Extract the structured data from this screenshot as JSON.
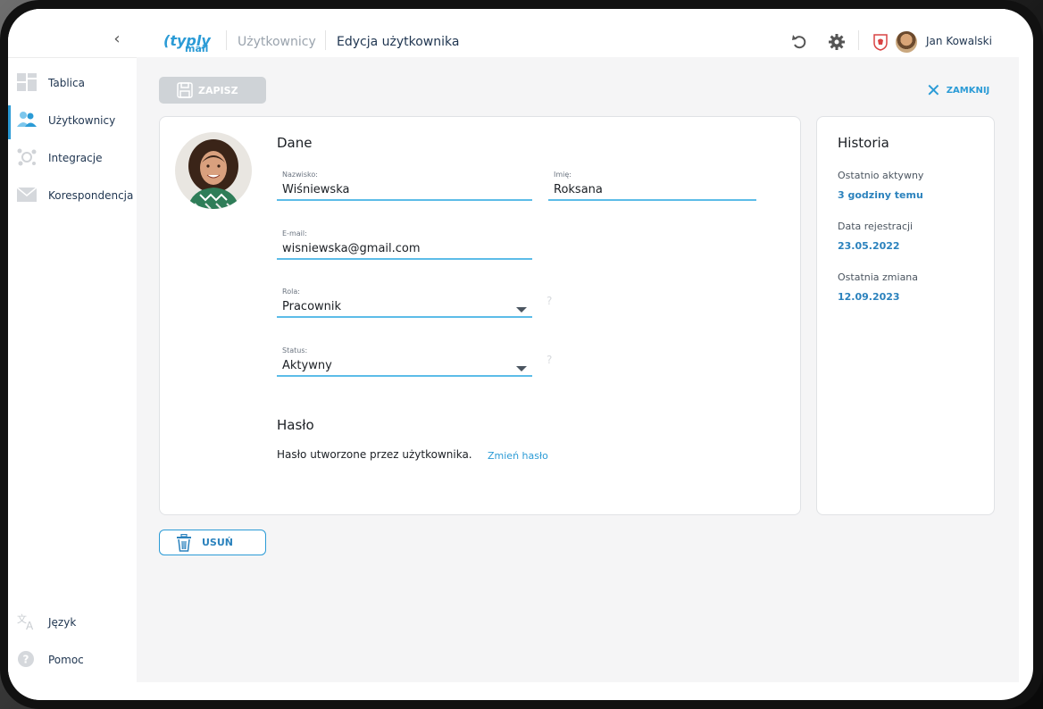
{
  "sidebar": {
    "collapse_icon": "chevron-left-icon",
    "items": [
      {
        "label": "Tablica",
        "icon": "dashboard-icon"
      },
      {
        "label": "Użytkownicy",
        "icon": "users-icon",
        "active": true
      },
      {
        "label": "Integracje",
        "icon": "integrations-icon"
      },
      {
        "label": "Korespondencja",
        "icon": "mail-icon"
      }
    ],
    "bottom_items": [
      {
        "label": "Język",
        "icon": "translate-icon"
      },
      {
        "label": "Pomoc",
        "icon": "help-icon"
      }
    ]
  },
  "header": {
    "logo": "typly mail",
    "breadcrumb": [
      "Użytkownicy",
      "Edycja użytkownika"
    ],
    "user_name": "Jan Kowalski"
  },
  "toolbar": {
    "save_label": "ZAPISZ",
    "close_label": "ZAMKNIJ",
    "delete_label": "USUŃ"
  },
  "form": {
    "section_title": "Dane",
    "surname": {
      "label": "Nazwisko:",
      "value": "Wiśniewska"
    },
    "name": {
      "label": "Imię:",
      "value": "Roksana"
    },
    "email": {
      "label": "E-mail:",
      "value": "wisniewska@gmail.com"
    },
    "role": {
      "label": "Rola:",
      "value": "Pracownik"
    },
    "status": {
      "label": "Status:",
      "value": "Aktywny"
    },
    "help_glyph": "?",
    "password_title": "Hasło",
    "password_text": "Hasło utworzone przez użytkownika.",
    "password_link": "Zmień hasło"
  },
  "history": {
    "title": "Historia",
    "entries": [
      {
        "label": "Ostatnio aktywny",
        "value": "3 godziny temu"
      },
      {
        "label": "Data rejestracji",
        "value": "23.05.2022"
      },
      {
        "label": "Ostatnia zmiana",
        "value": "12.09.2023"
      }
    ]
  },
  "colors": {
    "accent": "#2b9bd6",
    "field_underline": "#5cbce8",
    "save_disabled": "#cfd3d7",
    "background": "#f5f5f6"
  }
}
